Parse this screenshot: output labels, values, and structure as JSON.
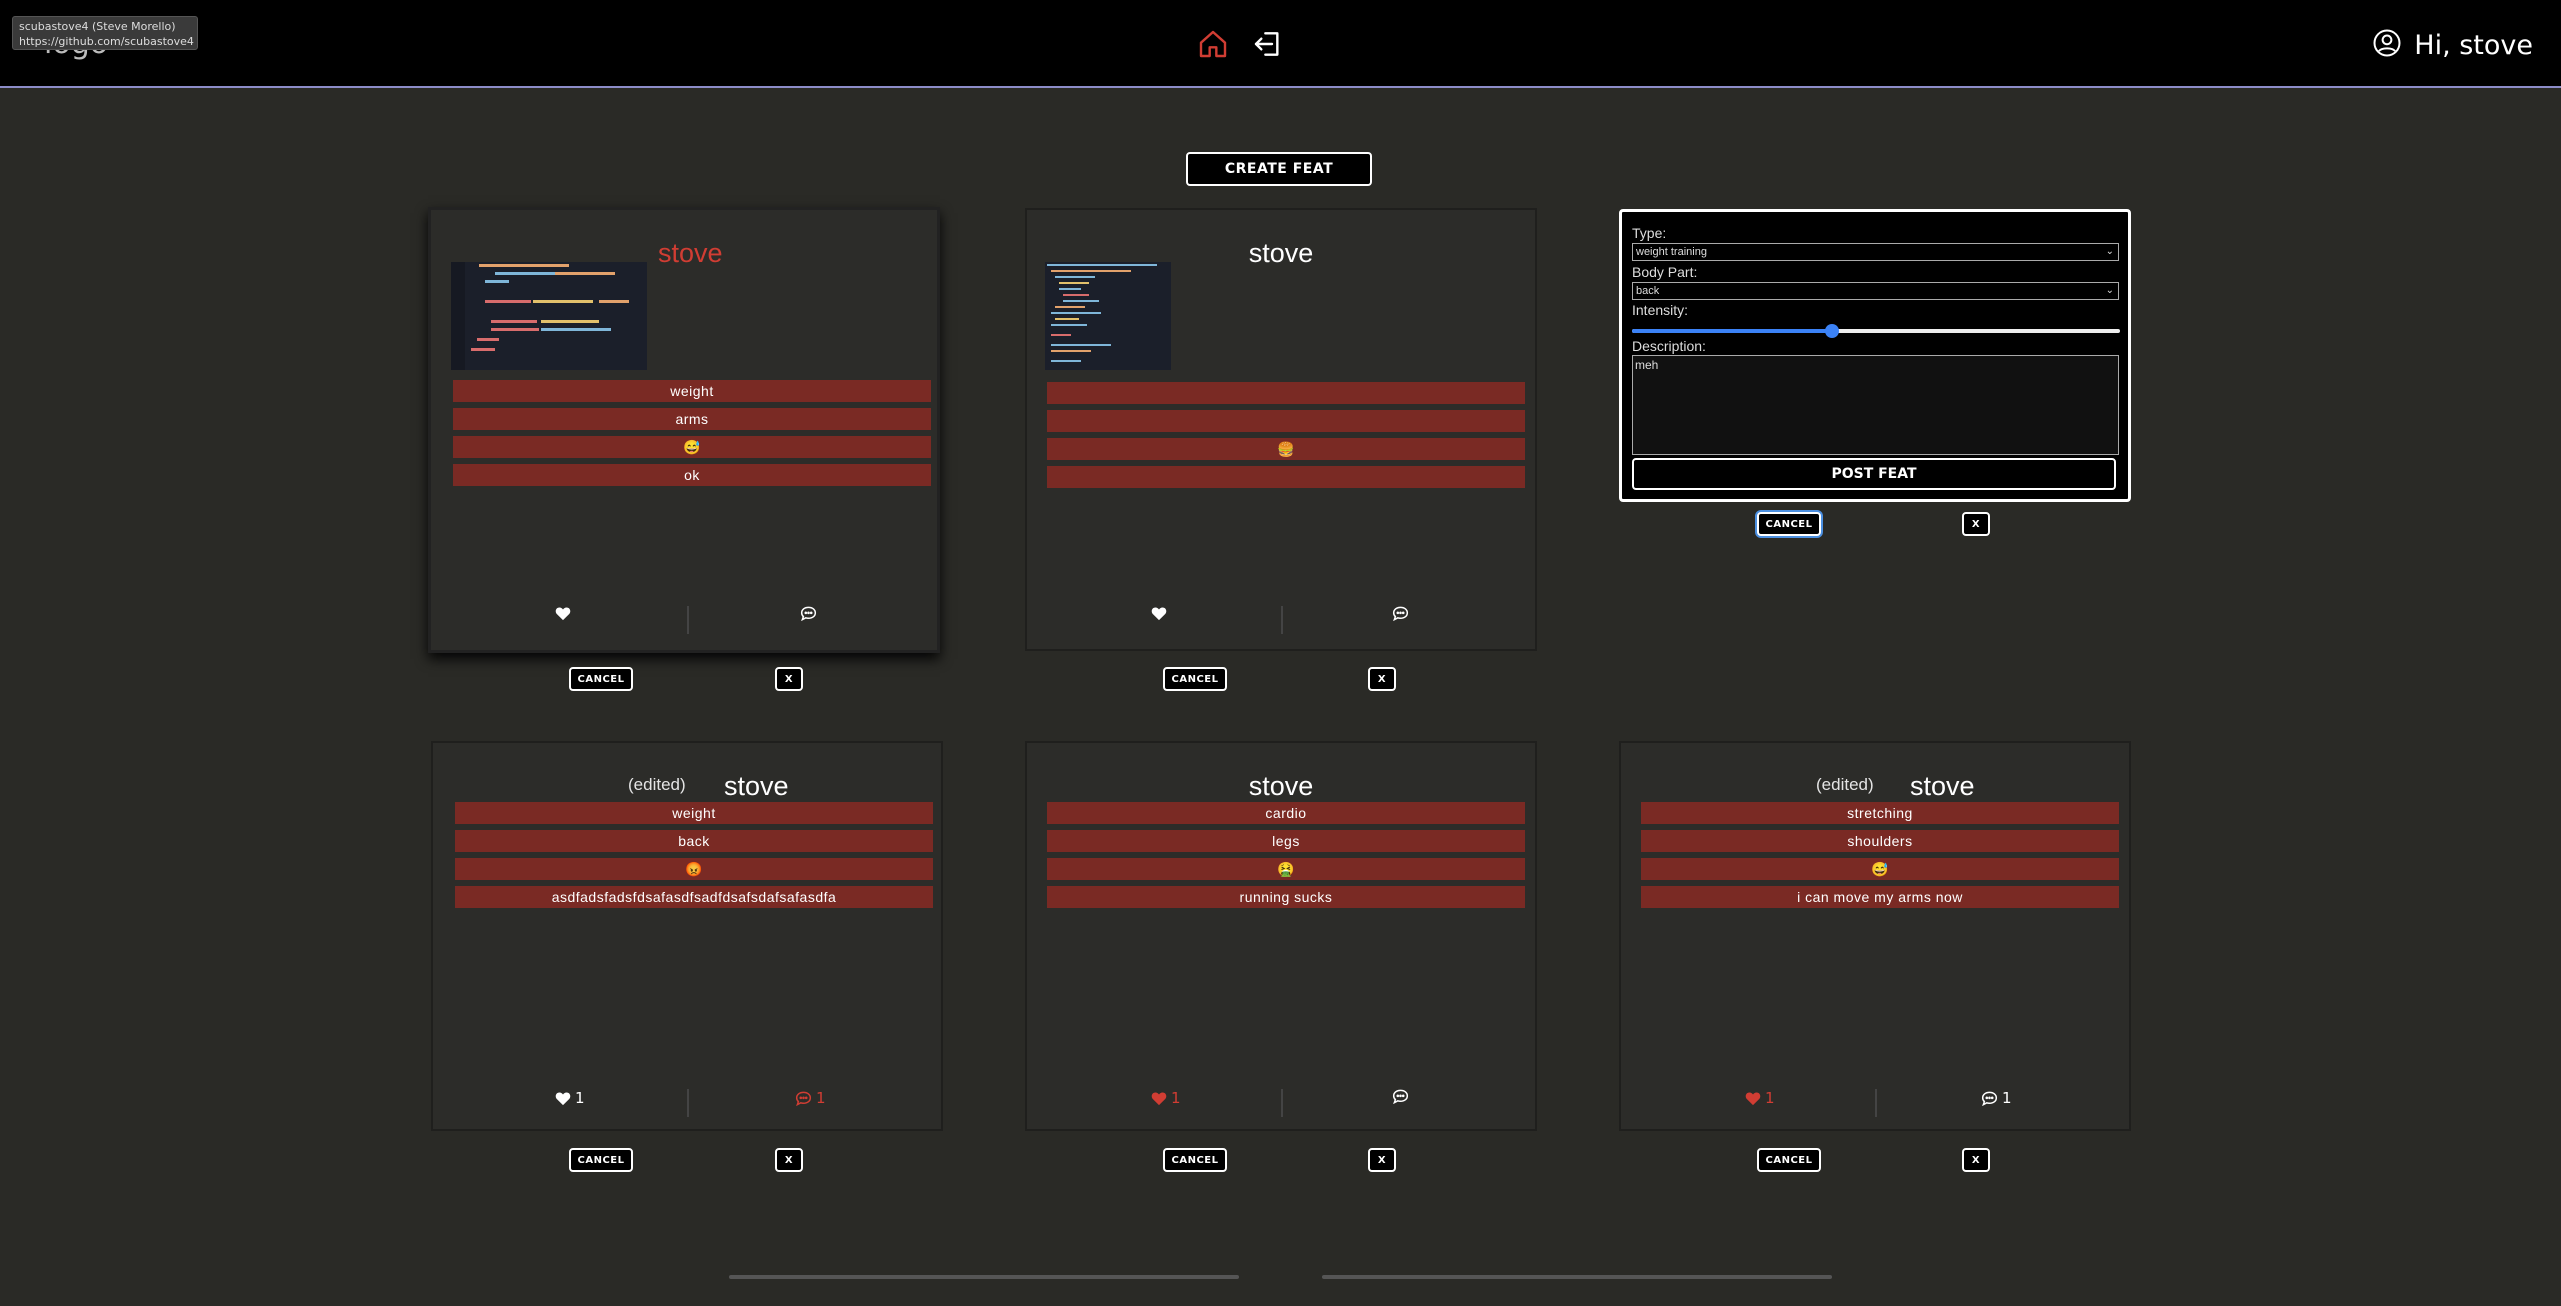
{
  "tooltip": {
    "line1": "scubastove4 (Steve Morello)",
    "line2": "https://github.com/scubastove4"
  },
  "nav": {
    "logo": "logo",
    "greeting": "Hi, stove",
    "home_icon": "home-icon",
    "logout_icon": "logout-icon",
    "user_icon": "user-circle-icon",
    "active_color": "#d13d33"
  },
  "create_button": "CREATE FEAT",
  "cancel_label": "CANCEL",
  "x_label": "X",
  "edited_label": "(edited)",
  "accent": "#7a2a24",
  "cards": [
    {
      "user": "stove",
      "type": "weight",
      "body_part": "arms",
      "intensity": "😅",
      "description": "ok",
      "likes": "",
      "comments": ""
    },
    {
      "user": "stove",
      "type": "",
      "body_part": "",
      "intensity": "🍔",
      "description": "",
      "likes": "",
      "comments": ""
    },
    {
      "user": "stove",
      "edited": "(edited)",
      "type": "weight",
      "body_part": "back",
      "intensity": "😡",
      "description": "asdfadsfadsfdsafasdfsadfdsafsdafsafasdfa",
      "likes": "1",
      "comments": "1"
    },
    {
      "user": "stove",
      "type": "cardio",
      "body_part": "legs",
      "intensity": "🤮",
      "description": "running sucks",
      "likes": "1",
      "comments": ""
    },
    {
      "user": "stove",
      "edited": "(edited)",
      "type": "stretching",
      "body_part": "shoulders",
      "intensity": "😅",
      "description": "i can move my arms now",
      "likes": "1",
      "comments": "1"
    }
  ],
  "form": {
    "type_label": "Type:",
    "type_value": "weight training",
    "body_label": "Body Part:",
    "body_value": "back",
    "intensity_label": "Intensity:",
    "intensity_fraction": 0.41,
    "description_label": "Description:",
    "description_value": "meh",
    "post_button": "POST FEAT"
  }
}
